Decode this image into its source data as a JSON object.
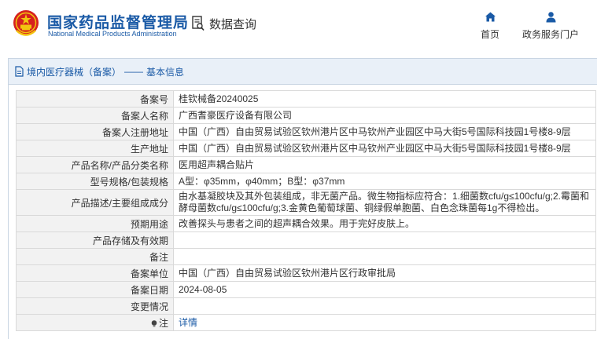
{
  "header": {
    "title_cn": "国家药品监督管理局",
    "title_en": "National Medical Products Administration",
    "data_query_label": "数据查询",
    "nav": [
      {
        "label": "首页",
        "icon": "home-icon"
      },
      {
        "label": "政务服务门户",
        "icon": "user-icon"
      }
    ]
  },
  "breadcrumb": {
    "section": "境内医疗器械（备案）",
    "separator": "——",
    "page": "基本信息"
  },
  "record": {
    "rows": [
      {
        "label": "备案号",
        "value": "桂钦械备20240025"
      },
      {
        "label": "备案人名称",
        "value": "广西耆豪医疗设备有限公司"
      },
      {
        "label": "备案人注册地址",
        "value": "中国（广西）自由贸易试验区钦州港片区中马钦州产业园区中马大街5号国际科技园1号楼8-9层"
      },
      {
        "label": "生产地址",
        "value": "中国（广西）自由贸易试验区钦州港片区中马钦州产业园区中马大街5号国际科技园1号楼8-9层"
      },
      {
        "label": "产品名称/产品分类名称",
        "value": "医用超声耦合贴片"
      },
      {
        "label": "型号规格/包装规格",
        "value": "A型：φ35mm，φ40mm；B型：φ37mm"
      },
      {
        "label": "产品描述/主要组成成分",
        "value": "由水基凝胶块及其外包装组成，非无菌产品。微生物指标应符合：1.细菌数cfu/g≤100cfu/g;2.霉菌和酵母菌数cfu/g≤100cfu/g;3.金黄色葡萄球菌、铜绿假单胞菌、白色念珠菌每1g不得检出。"
      },
      {
        "label": "预期用途",
        "value": "改善探头与患者之间的超声耦合效果。用于完好皮肤上。"
      },
      {
        "label": "产品存储及有效期",
        "value": ""
      },
      {
        "label": "备注",
        "value": ""
      },
      {
        "label": "备案单位",
        "value": "中国（广西）自由贸易试验区钦州港片区行政审批局"
      },
      {
        "label": "备案日期",
        "value": "2024-08-05"
      },
      {
        "label": "变更情况",
        "value": ""
      }
    ],
    "note_row": {
      "label": "注",
      "link": "详情",
      "icon": "lightbulb-icon"
    }
  },
  "colors": {
    "brand_blue": "#1a5aa6",
    "emblem_red": "#d6201f",
    "emblem_gold": "#f2c40f",
    "label_bg": "#f2f2f2",
    "breadcrumb_bg": "#e9f0f8",
    "border": "#d9d9d9"
  }
}
